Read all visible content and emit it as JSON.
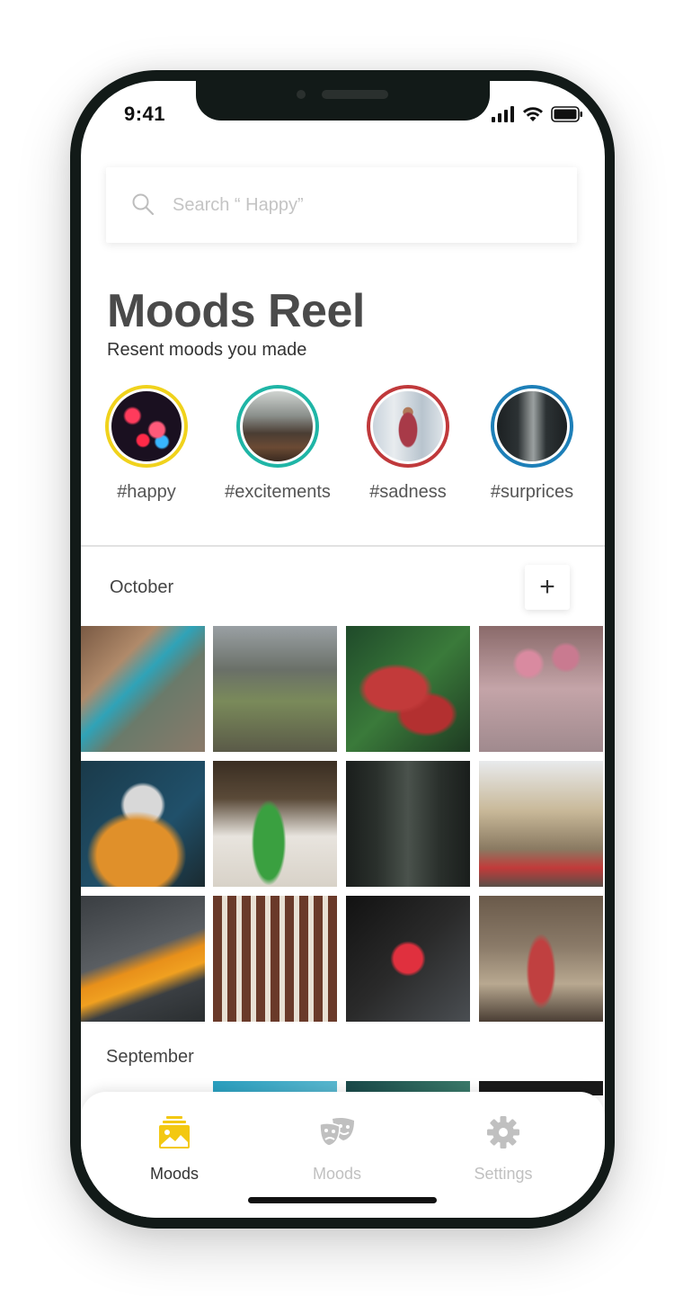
{
  "status": {
    "time": "9:41"
  },
  "search": {
    "placeholder": "Search “ Happy”"
  },
  "header": {
    "title": "Moods Reel",
    "subtitle": "Resent moods you made"
  },
  "stories": [
    {
      "label": "#happy",
      "ring_color": "#f0d21c",
      "thumb": "neon-sign"
    },
    {
      "label": "#excitements",
      "ring_color": "#1fb5a6",
      "thumb": "forest-path"
    },
    {
      "label": "#sadness",
      "ring_color": "#c0393b",
      "thumb": "man-standing"
    },
    {
      "label": "#surprices",
      "ring_color": "#1d7fb8",
      "thumb": "tree-avenue"
    }
  ],
  "sections": [
    {
      "month": "October",
      "add_label": "+"
    },
    {
      "month": "September"
    }
  ],
  "tabbar": {
    "tabs": [
      {
        "label": "Moods",
        "icon": "photo-stack-icon",
        "active": true,
        "color": "#f3c812"
      },
      {
        "label": "Moods",
        "icon": "theater-masks-icon",
        "active": false
      },
      {
        "label": "Settings",
        "icon": "gear-icon",
        "active": false
      }
    ]
  },
  "colors": {
    "accent": "#f3c812",
    "inactive": "#c0c0c0",
    "text": "#4a4a4a"
  }
}
